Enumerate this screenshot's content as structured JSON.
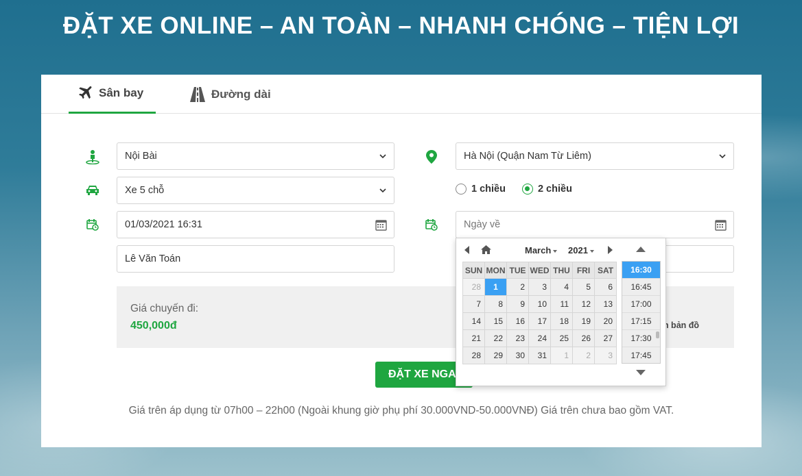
{
  "headline": "ĐẶT XE ONLINE – AN TOÀN – NHANH CHÓNG – TIỆN LỢI",
  "tabs": [
    {
      "label": "Sân bay",
      "icon": "airplane-icon",
      "active": true
    },
    {
      "label": "Đường dài",
      "icon": "road-icon",
      "active": false
    }
  ],
  "form": {
    "pickup": {
      "value": "Nội Bài",
      "icon": "person-pin-icon"
    },
    "destination": {
      "value": "Hà Nội (Quận Nam Từ Liêm)",
      "icon": "map-marker-icon"
    },
    "car_type": {
      "value": "Xe 5 chỗ",
      "icon": "car-icon"
    },
    "trip": {
      "one_way": "1 chiều",
      "round_trip": "2 chiều",
      "selected": "2 chiều"
    },
    "depart_datetime": {
      "value": "01/03/2021 16:31",
      "icon": "calendar-clock-icon"
    },
    "return_date": {
      "placeholder": "Ngày về",
      "icon": "calendar-clock-icon"
    },
    "name": {
      "value": "Lê Văn Toán"
    }
  },
  "price": {
    "label": "Giá chuyến đi:",
    "value": "450,000đ",
    "map_link": "ện bản đồ"
  },
  "book_button": "ĐẶT XE NGA",
  "note": "Giá trên áp dụng từ 07h00 – 22h00 (Ngoài khung giờ phụ phí 30.000VND-50.000VNĐ) Giá trên chưa bao gồm VAT.",
  "datepicker": {
    "month": "March",
    "year": "2021",
    "weekdays": [
      "SUN",
      "MON",
      "TUE",
      "WED",
      "THU",
      "FRI",
      "SAT"
    ],
    "weeks": [
      [
        {
          "d": "28",
          "o": true
        },
        {
          "d": "1",
          "s": true
        },
        {
          "d": "2"
        },
        {
          "d": "3"
        },
        {
          "d": "4"
        },
        {
          "d": "5"
        },
        {
          "d": "6"
        }
      ],
      [
        {
          "d": "7"
        },
        {
          "d": "8"
        },
        {
          "d": "9"
        },
        {
          "d": "10"
        },
        {
          "d": "11"
        },
        {
          "d": "12"
        },
        {
          "d": "13"
        }
      ],
      [
        {
          "d": "14"
        },
        {
          "d": "15"
        },
        {
          "d": "16"
        },
        {
          "d": "17"
        },
        {
          "d": "18"
        },
        {
          "d": "19"
        },
        {
          "d": "20"
        }
      ],
      [
        {
          "d": "21"
        },
        {
          "d": "22"
        },
        {
          "d": "23"
        },
        {
          "d": "24"
        },
        {
          "d": "25"
        },
        {
          "d": "26"
        },
        {
          "d": "27"
        }
      ],
      [
        {
          "d": "28"
        },
        {
          "d": "29"
        },
        {
          "d": "30"
        },
        {
          "d": "31"
        },
        {
          "d": "1",
          "o": true
        },
        {
          "d": "2",
          "o": true
        },
        {
          "d": "3",
          "o": true
        }
      ]
    ],
    "times": [
      "16:30",
      "16:45",
      "17:00",
      "17:15",
      "17:30",
      "17:45"
    ],
    "selected_time": "16:30"
  },
  "colors": {
    "accent": "#1fa640",
    "selection": "#3aa0f3"
  }
}
